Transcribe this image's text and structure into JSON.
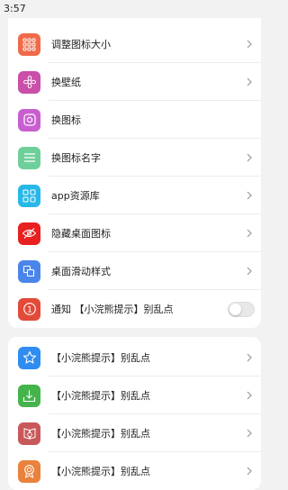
{
  "status_bar": {
    "time": "3:57"
  },
  "settings": {
    "items": [
      {
        "label": "调整图标大小",
        "icon": "grid-icon",
        "color": "#f06a4a"
      },
      {
        "label": "换壁纸",
        "icon": "flower-icon",
        "color": "#c94fa8"
      },
      {
        "label": "换图标",
        "icon": "square-icon",
        "color": "#c85fd0"
      },
      {
        "label": "换图标名字",
        "icon": "lines-icon",
        "color": "#6fcf9a"
      },
      {
        "label": "app资源库",
        "icon": "app-library-icon",
        "color": "#28b8e8"
      },
      {
        "label": "隐藏桌面图标",
        "icon": "eye-hidden-icon",
        "color": "#e82020"
      },
      {
        "label": "桌面滑动样式",
        "icon": "layers-icon",
        "color": "#4a86ea"
      },
      {
        "label": "通知 【小浣熊提示】别乱点",
        "icon": "notice-icon",
        "color": "#e24a3a",
        "toggle": false
      }
    ]
  },
  "tips": {
    "items": [
      {
        "label": "【小浣熊提示】别乱点",
        "icon": "star-icon",
        "color": "#2f8cf0"
      },
      {
        "label": "【小浣熊提示】别乱点",
        "icon": "download-icon",
        "color": "#46b44c"
      },
      {
        "label": "【小浣熊提示】别乱点",
        "icon": "book-icon",
        "color": "#c9585a"
      },
      {
        "label": "【小浣熊提示】别乱点",
        "icon": "badge-icon",
        "color": "#e9823c"
      }
    ]
  }
}
